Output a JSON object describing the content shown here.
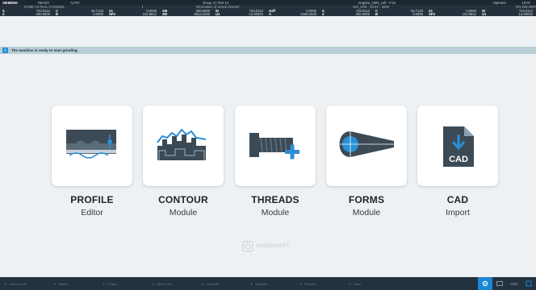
{
  "topbar": {
    "status": {
      "logo": "SIEMENS",
      "mode": "READY",
      "auto": "AUTO",
      "program": "Group 3 | Part 13",
      "angle": "Angular_CBN_Left - P.01",
      "user": "Operator",
      "time": "10:07"
    },
    "info": {
      "channel": "NAME ACTUAL CHANNEL",
      "info_label": "Information of actual channel",
      "wheel": "102_G09 - XXXX - 3000",
      "serial": "DN 426-4987"
    },
    "axes_row1": [
      {
        "l": "X",
        "v": "742.9113"
      },
      {
        "l": "C",
        "v": "34.7133"
      },
      {
        "l": "Zs",
        "v": "0.0000"
      },
      {
        "l": "XM",
        "v": "300.0000"
      },
      {
        "l": "W",
        "v": "734.0112"
      },
      {
        "l": "Zoff",
        "v": "0.0000"
      },
      {
        "l": "X",
        "v": "742.9113"
      },
      {
        "l": "C",
        "v": "34.7133"
      },
      {
        "l": "Zs",
        "v": "0.0000"
      },
      {
        "l": "W",
        "v": "734.0112"
      }
    ],
    "axes_row2": [
      {
        "l": "Z",
        "v": "400.0000"
      },
      {
        "l": "B",
        "v": "0.0000"
      },
      {
        "l": "SP2",
        "v": "102.9812"
      },
      {
        "l": "ZM",
        "v": "4813.2230"
      },
      {
        "l": "U1",
        "v": "13.00022"
      },
      {
        "l": "A",
        "v": "2186.3333"
      },
      {
        "l": "Z",
        "v": "400.0000"
      },
      {
        "l": "B",
        "v": "0.0000"
      },
      {
        "l": "SP2",
        "v": "102.9812"
      },
      {
        "l": "U1",
        "v": "13.00022"
      }
    ]
  },
  "message": {
    "icon": "i",
    "text": "The machine is ready to start grinding."
  },
  "cards": [
    {
      "title": "PROFILE",
      "subtitle": "Editor"
    },
    {
      "title": "CONTOUR",
      "subtitle": "Module"
    },
    {
      "title": "THREADS",
      "subtitle": "Module"
    },
    {
      "title": "FORMS",
      "subtitle": "Module"
    },
    {
      "title": "CAD",
      "subtitle": "Import"
    }
  ],
  "cad_icon_text": "CAD",
  "watermark_text": "TANDEMSOFT",
  "bottombar": {
    "items": [
      "Select mode",
      "Search",
      "Project",
      "Select Tool",
      "Generate",
      "Simulate",
      "Process",
      "Save"
    ],
    "right_buttons": [
      "settings",
      "keyboard",
      "CNC",
      "Program"
    ]
  },
  "colors": {
    "accent": "#1a86d6",
    "topbar_bg": "#24303c",
    "message_bg": "#b9ced6",
    "canvas_bg": "#eef1f3",
    "icon_blue": "#2a8fd6",
    "icon_dark": "#3c4a56"
  }
}
